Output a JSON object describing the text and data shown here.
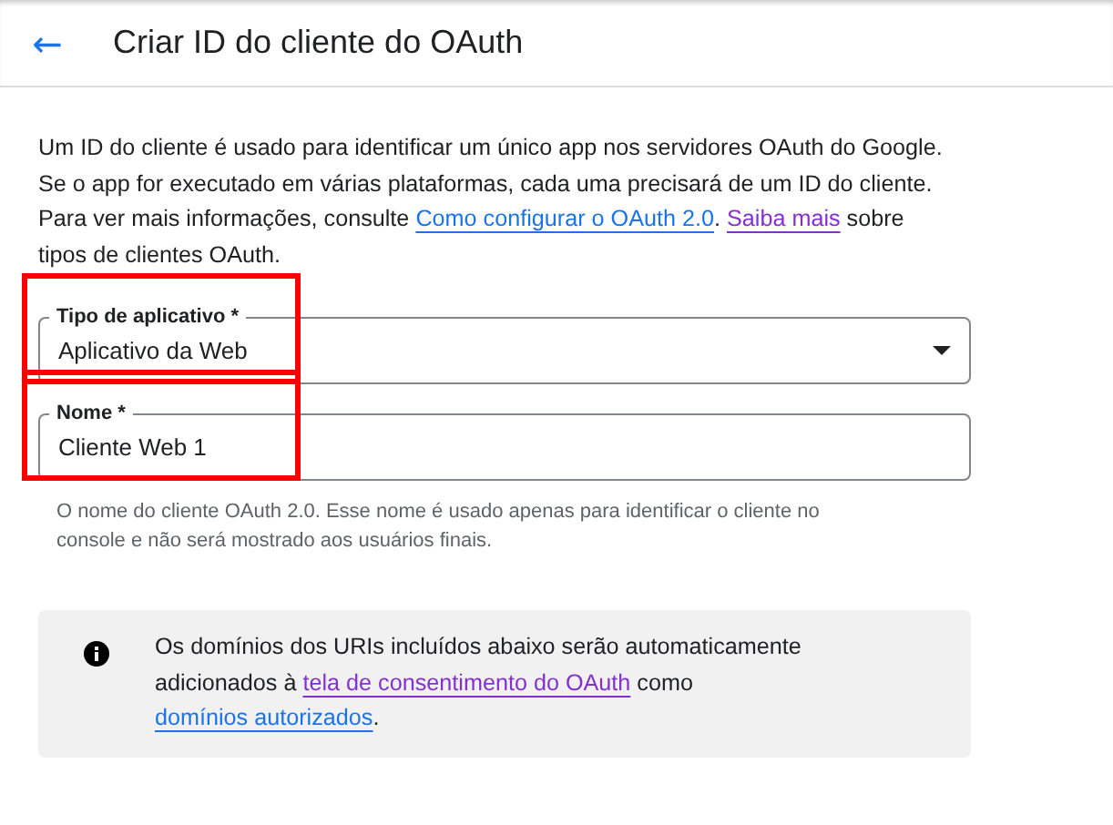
{
  "header": {
    "back": "←",
    "title": "Criar ID do cliente do OAuth"
  },
  "intro": [
    {
      "kind": "text",
      "text": "Um ID do cliente é usado para identificar um único app nos servidores OAuth do Google. Se o app for executado em várias plataformas, cada uma precisará de um ID do cliente. Para ver mais informações, consulte "
    },
    {
      "kind": "link",
      "text": "Como configurar o OAuth 2.0",
      "visited": false
    },
    {
      "kind": "text",
      "text": ". "
    },
    {
      "kind": "link",
      "text": "Saiba mais",
      "visited": true
    },
    {
      "kind": "text",
      "text": " sobre tipos de clientes OAuth."
    }
  ],
  "fields": [
    {
      "kind": "select",
      "label": "Tipo de aplicativo *",
      "value": "Aplicativo da Web",
      "highlighted": true
    },
    {
      "kind": "text",
      "label": "Nome *",
      "value": "Cliente Web 1",
      "highlighted": true,
      "hint": "O nome do cliente OAuth 2.0. Esse nome é usado apenas para identificar o cliente no console e não será mostrado aos usuários finais."
    }
  ],
  "notice": [
    {
      "kind": "text",
      "text": "Os domínios dos URIs incluídos abaixo serão automaticamente adicionados à "
    },
    {
      "kind": "link",
      "text": "tela de consentimento do OAuth",
      "visited": true
    },
    {
      "kind": "text",
      "text": " como "
    },
    {
      "kind": "link",
      "text": "domínios autorizados",
      "visited": false
    },
    {
      "kind": "text",
      "text": "."
    }
  ]
}
